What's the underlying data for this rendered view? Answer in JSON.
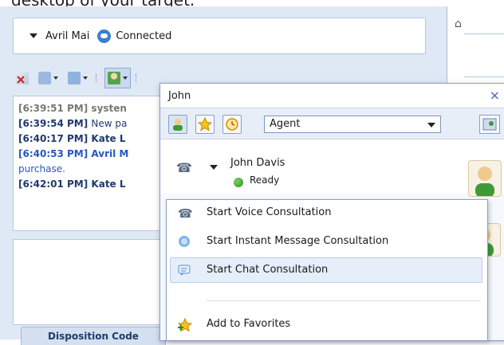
{
  "caption": {
    "text": "desktop of your target."
  },
  "contact_bar": {
    "name": "Avril Mai",
    "status": "Connected"
  },
  "transcript": {
    "lines": [
      {
        "time": "[6:39:51 PM]",
        "sender": "systen"
      },
      {
        "time": "[6:39:54 PM]",
        "sender": "New pa"
      },
      {
        "time": "[6:40:17 PM]",
        "sender": "Kate L"
      },
      {
        "time": "[6:40:53 PM]",
        "sender": "Avril M"
      },
      {
        "time": "",
        "sender": "purchase."
      },
      {
        "time": "[6:42:01 PM]",
        "sender": "Kate L"
      }
    ]
  },
  "disposition_tab": {
    "label": "Disposition Code"
  },
  "popup": {
    "title": "John",
    "close_glyph": "×",
    "filter_select": "Agent",
    "contact": {
      "name": "John Davis",
      "status": "Ready"
    }
  },
  "menu": {
    "items": [
      {
        "label": "Start Voice Consultation",
        "icon": "phone-icon"
      },
      {
        "label": "Start Instant Message Consultation",
        "icon": "im-bubble-icon"
      },
      {
        "label": "Start Chat Consultation",
        "icon": "chat-icon"
      },
      {
        "label": "Add to Favorites",
        "icon": "star-add-icon"
      }
    ]
  }
}
